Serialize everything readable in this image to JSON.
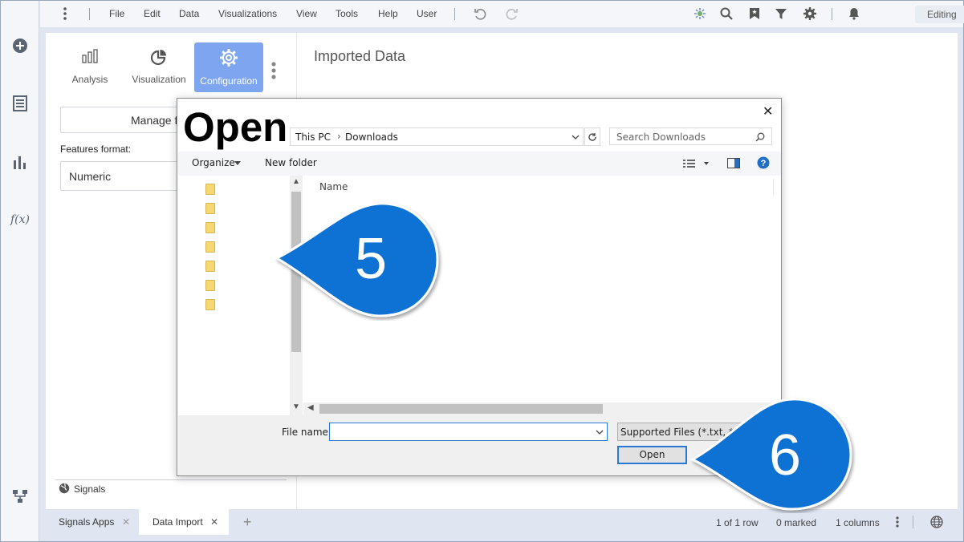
{
  "menubar": {
    "items": [
      "File",
      "Edit",
      "Data",
      "Visualizations",
      "View",
      "Tools",
      "Help",
      "User"
    ],
    "mode": "Editing"
  },
  "left_panel": {
    "tabs": [
      {
        "label": "Analysis",
        "icon": "analysis-icon",
        "active": false
      },
      {
        "label": "Visualization",
        "icon": "pie-chart-icon",
        "active": false
      },
      {
        "label": "Configuration",
        "icon": "gear-icon",
        "active": true
      }
    ],
    "manage_button": "Manage f",
    "features_format_label": "Features format:",
    "features_format_value": "Numeric",
    "signals_label": "Signals"
  },
  "main": {
    "title": "Imported Data"
  },
  "dialog": {
    "title": "Open",
    "breadcrumb": [
      "This PC",
      "Downloads"
    ],
    "search_placeholder": "Search Downloads",
    "organize_label": "Organize",
    "new_folder_label": "New folder",
    "column_name": "Name",
    "file_name_label": "File name:",
    "file_name_value": "",
    "file_type": "Supported Files (*.txt, *.cs",
    "open_button": "Open",
    "folder_count": 7
  },
  "callouts": [
    {
      "number": "5"
    },
    {
      "number": "6"
    }
  ],
  "bottom_bar": {
    "tabs": [
      {
        "label": "Signals Apps",
        "active": false
      },
      {
        "label": "Data Import",
        "active": true
      }
    ],
    "rows": "1 of 1 row",
    "marked": "0 marked",
    "columns": "1 columns"
  },
  "colors": {
    "accent": "#7ea6f0",
    "callout": "#0a72d4",
    "rail_bg": "#f4f6fa"
  }
}
